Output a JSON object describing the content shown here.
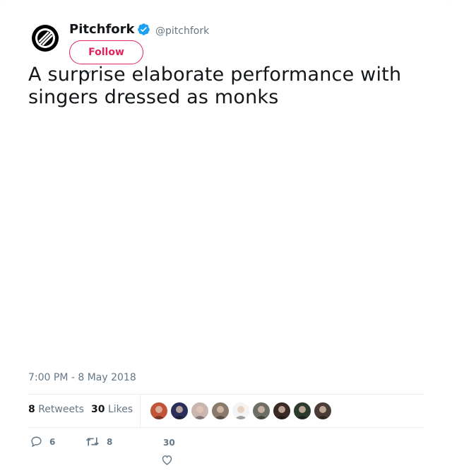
{
  "author": {
    "name": "Pitchfork",
    "handle": "@pitchfork",
    "verified": true,
    "avatar_icon": "pitchfork-logo-icon"
  },
  "follow_button": {
    "label": "Follow"
  },
  "tweet": {
    "text_line1": "A surprise elaborate performance with",
    "text_line2": "singers dressed as monks",
    "timestamp": "7:00 PM - 8 May 2018"
  },
  "stats": {
    "retweets_count": "8",
    "retweets_label": "Retweets",
    "likes_count": "30",
    "likes_label": "Likes"
  },
  "likers": [
    {
      "icon": "liker-avatar-1",
      "color": "#c0553a"
    },
    {
      "icon": "liker-avatar-2",
      "color": "#2a2f5a"
    },
    {
      "icon": "liker-avatar-3",
      "color": "#c9b6ae"
    },
    {
      "icon": "liker-avatar-4",
      "color": "#8a7a6c"
    },
    {
      "icon": "liker-avatar-5",
      "color": "#f4f4f4"
    },
    {
      "icon": "liker-avatar-6",
      "color": "#6e6e66"
    },
    {
      "icon": "liker-avatar-7",
      "color": "#3a2a26"
    },
    {
      "icon": "liker-avatar-8",
      "color": "#2d3a2e"
    },
    {
      "icon": "liker-avatar-9",
      "color": "#4a3c36"
    }
  ],
  "actions": {
    "reply_count": "6",
    "retweet_count": "8",
    "like_count": "30"
  },
  "colors": {
    "follow_accent": "#e0245e",
    "verified_blue": "#1da1f2",
    "muted_text": "#657786",
    "primary_text": "#14171a"
  }
}
